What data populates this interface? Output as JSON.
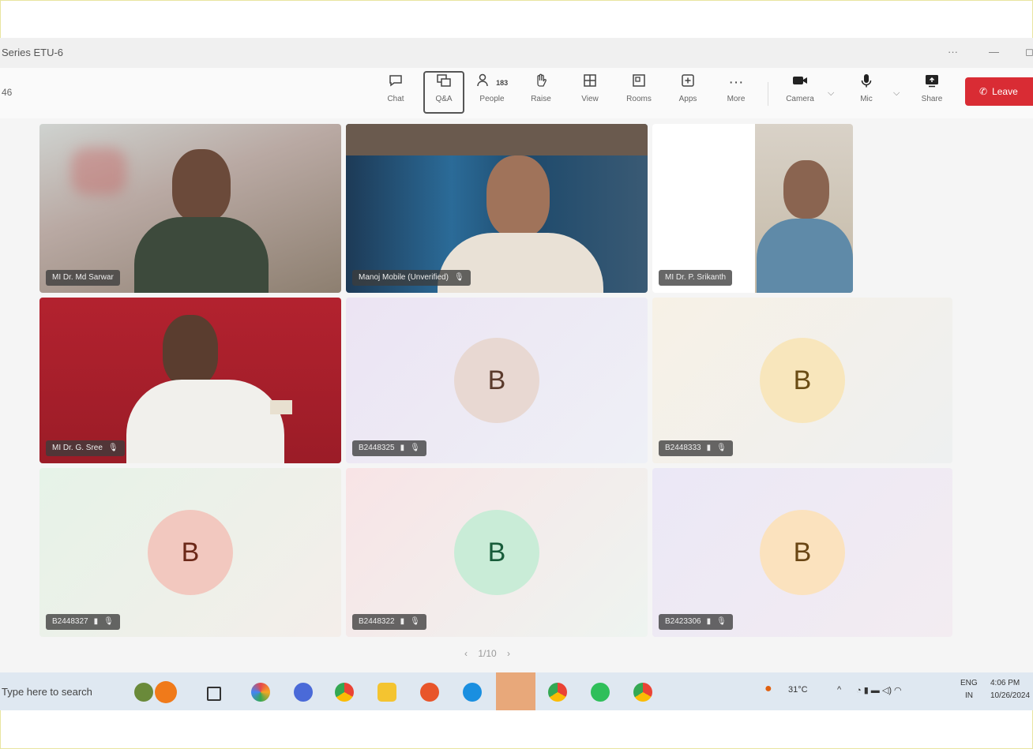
{
  "window": {
    "title": "Series ETU-6",
    "controls": [
      "···",
      "—",
      "◻"
    ]
  },
  "toolbar": {
    "left_text": "46",
    "buttons": [
      {
        "label": "Chat",
        "icon": "chat-icon"
      },
      {
        "label": "Q&A",
        "icon": "qa-icon"
      },
      {
        "label": "People",
        "icon": "people-icon",
        "count": "183"
      },
      {
        "label": "Raise",
        "icon": "hand-icon"
      },
      {
        "label": "View",
        "icon": "grid-icon"
      },
      {
        "label": "Rooms",
        "icon": "rooms-icon"
      },
      {
        "label": "Apps",
        "icon": "apps-icon"
      },
      {
        "label": "More",
        "icon": "more-icon"
      },
      {
        "label": "Camera",
        "icon": "camera-icon"
      },
      {
        "label": "Mic",
        "icon": "mic-icon"
      },
      {
        "label": "Share",
        "icon": "share-icon"
      }
    ],
    "leave_label": "Leave"
  },
  "participants": [
    {
      "name": "MI Dr. Md Sarwar",
      "type": "video"
    },
    {
      "name": "Manoj Mobile (Unverified)",
      "type": "video"
    },
    {
      "name": "MI Dr. P. Srikanth",
      "type": "video"
    },
    {
      "name": "MI Dr. G. Sree",
      "type": "video"
    },
    {
      "name": "B2448325",
      "type": "avatar",
      "initial": "B",
      "bg": "#e8d8d2",
      "fg": "#5a3a2c"
    },
    {
      "name": "B2448333",
      "type": "avatar",
      "initial": "B",
      "bg": "#f8e6bc",
      "fg": "#6a4c14"
    },
    {
      "name": "B2448327",
      "type": "avatar",
      "initial": "B",
      "bg": "#f2c8bf",
      "fg": "#6c2818"
    },
    {
      "name": "B2448322",
      "type": "avatar",
      "initial": "B",
      "bg": "#c9ecd7",
      "fg": "#185c3a"
    },
    {
      "name": "B2423306",
      "type": "avatar",
      "initial": "B",
      "bg": "#fbe2be",
      "fg": "#6a4614"
    }
  ],
  "pager": {
    "prev": "‹",
    "text": "1/10",
    "next": "›"
  },
  "taskbar": {
    "search_text": "Type here to search",
    "weather": "31°C",
    "lang": "ENG",
    "region": "IN",
    "time": "4:06 PM",
    "date": "10/26/2024"
  }
}
